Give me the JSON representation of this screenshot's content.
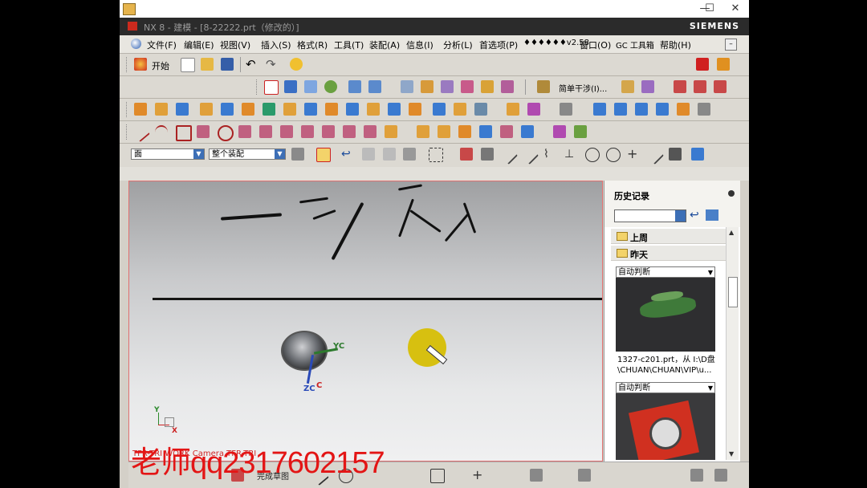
{
  "window": {
    "outer_title": "",
    "nx_title": "NX 8 - 建模 - [8-22222.prt（修改的）]",
    "brand": "SIEMENS",
    "controls": {
      "minimize": "—",
      "maximize": "☐",
      "close": "✕"
    }
  },
  "menu": {
    "items": [
      "文件(F)",
      "编辑(E)",
      "视图(V)",
      "插入(S)",
      "格式(R)",
      "工具(T)",
      "装配(A)",
      "信息(I)",
      "分析(L)",
      "首选项(P)",
      "♦♦♦♦♦♦v2.58",
      "窗口(O)",
      "GC 工具箱",
      "帮助(H)"
    ]
  },
  "toolbar": {
    "start_label": "开始",
    "simple_step_label": "简单干涉(I)..."
  },
  "selection_bar": {
    "filter_value": "面",
    "scope_value": "整个装配"
  },
  "viewport": {
    "wcs_labels": {
      "yc": "YC",
      "zc": "ZC",
      "c": "C"
    },
    "triad_labels": {
      "x": "X",
      "y": "Y"
    },
    "status_text": "TFR-TRI WORK Camera TFR-TRI"
  },
  "watermark": "老师qq2317602157",
  "history_panel": {
    "title": "历史记录",
    "groups": [
      "上周",
      "昨天"
    ],
    "entries": [
      {
        "mode": "自动判断",
        "caption_line1": "1327-c201.prt，从 I:\\D盘",
        "caption_line2": "\\CHUAN\\CHUAN\\VIP\\u..."
      },
      {
        "mode": "自动判断"
      }
    ]
  },
  "bottom_bar": {
    "label": "完成草图"
  }
}
